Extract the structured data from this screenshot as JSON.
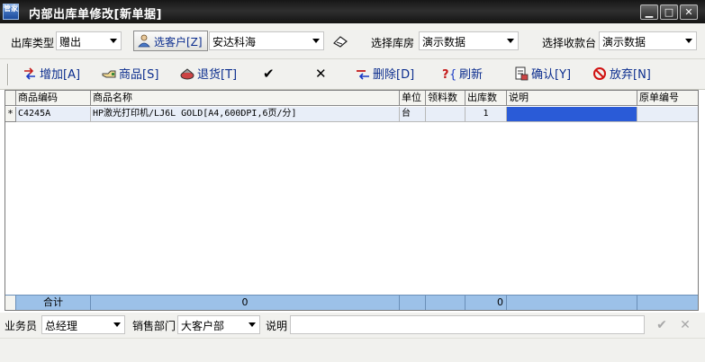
{
  "window": {
    "title": "内部出库单修改[新单据]",
    "icon_text": "管家",
    "minimize_glyph": "▁",
    "maximize_glyph": "□",
    "close_glyph": "✕"
  },
  "filters": {
    "outbound_type_label": "出库类型",
    "outbound_type_value": "赠出",
    "select_customer_label": "选客户[Z]",
    "customer_value": "安达科海",
    "select_warehouse_label": "选择库房",
    "warehouse_value": "演示数据",
    "select_cashier_label": "选择收款台",
    "cashier_value": "演示数据"
  },
  "toolbar": {
    "add_label": "增加[A]",
    "goods_label": "商品[S]",
    "return_label": "退货[T]",
    "check_glyph": "✔",
    "cross_glyph": "✕",
    "delete_label": "删除[D]",
    "refresh_label": "刷新",
    "confirm_label": "确认[Y]",
    "cancel_label": "放弃[N]"
  },
  "grid": {
    "columns": [
      "商品编码",
      "商品名称",
      "单位",
      "领料数",
      "出库数",
      "说明",
      "原单编号"
    ],
    "rows": [
      {
        "indicator": "*",
        "code": "C4245A",
        "name": "HP激光打印机/LJ6L GOLD[A4,600DPI,6页/分]",
        "unit": "台",
        "picked_qty": "",
        "out_qty": "1",
        "note": "",
        "orig_no": ""
      }
    ],
    "total_label": "合计",
    "total_picked": "0",
    "total_out": "0"
  },
  "bottom": {
    "salesperson_label": "业务员",
    "salesperson_value": "总经理",
    "dept_label": "销售部门",
    "dept_value": "大客户部",
    "note_label": "说明",
    "note_value": ""
  }
}
